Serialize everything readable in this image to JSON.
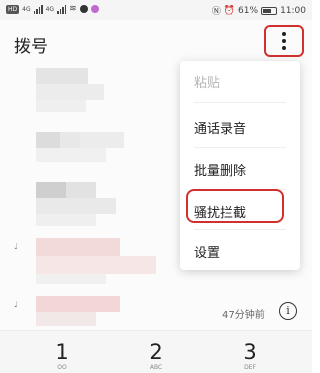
{
  "status_bar": {
    "network_badge": "HD",
    "signal_1": "4G",
    "signal_2": "4G",
    "battery": "61%",
    "time": "11:00"
  },
  "header": {
    "title": "拨号",
    "more_icon": "more-vertical-icon"
  },
  "menu": {
    "items": [
      {
        "label": "粘贴",
        "enabled": false
      },
      {
        "label": "通话录音",
        "enabled": true
      },
      {
        "label": "批量删除",
        "enabled": true
      },
      {
        "label": "骚扰拦截",
        "enabled": true,
        "highlighted": true
      },
      {
        "label": "设置",
        "enabled": true
      }
    ]
  },
  "call_log": {
    "last_call_time": "47分钟前",
    "info_icon": "info-icon"
  },
  "dialpad": {
    "keys": [
      {
        "digit": "1",
        "letters": "OO"
      },
      {
        "digit": "2",
        "letters": "ABC"
      },
      {
        "digit": "3",
        "letters": "DEF"
      }
    ]
  },
  "colors": {
    "highlight": "#d0312d",
    "disabled_text": "#b5b5b5"
  }
}
